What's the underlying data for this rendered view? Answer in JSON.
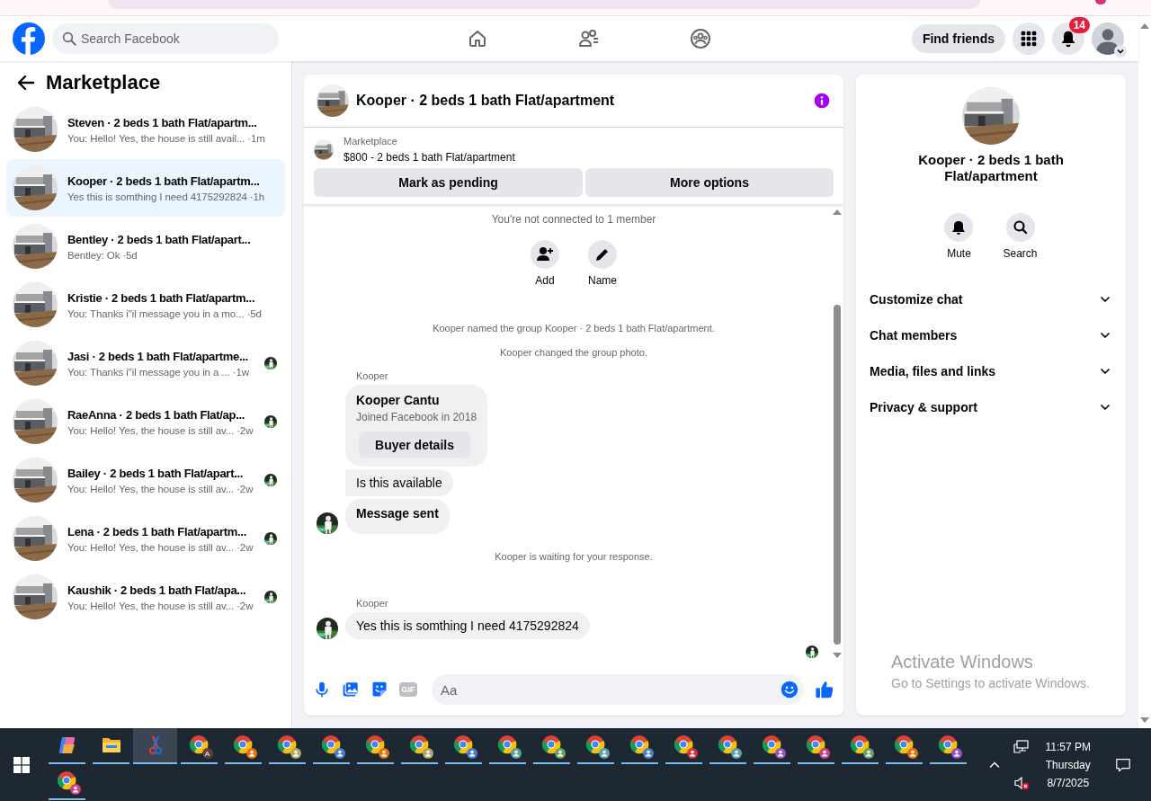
{
  "topbar": {
    "search": {
      "placeholder": "Search Facebook"
    },
    "nav": [
      {
        "kind": "home"
      },
      {
        "kind": "friends"
      },
      {
        "kind": "groups"
      }
    ],
    "find_friends": "Find friends",
    "notifications_count": "14"
  },
  "sidebar": {
    "title": "Marketplace",
    "conversations": [
      {
        "title": "Steven · 2 beds 1 bath Flat/apartm...",
        "preview": "You: Hello! Yes, the house is still avail...",
        "time": "·1m",
        "selected": false,
        "participant": false
      },
      {
        "title": "Kooper · 2 beds 1 bath Flat/apartm...",
        "preview": "Yes this is somthing I need 4175292824",
        "time": "·1h",
        "selected": true,
        "participant": false
      },
      {
        "title": "Bentley · 2 beds 1 bath Flat/apart...",
        "preview": "Bentley: Ok",
        "time": "·5d",
        "selected": false,
        "participant": false
      },
      {
        "title": "Kristie · 2 beds 1 bath Flat/apartm...",
        "preview": "You: Thanks i\"il message you in a mo...",
        "time": "·5d",
        "selected": false,
        "participant": false
      },
      {
        "title": "Jasi · 2 beds 1 bath Flat/apartme...",
        "preview": "You: Thanks i\"il message you in a ...",
        "time": "·1w",
        "selected": false,
        "participant": true
      },
      {
        "title": "RaeAnna · 2 beds 1 bath Flat/ap...",
        "preview": "You: Hello! Yes, the house is still av...",
        "time": "·2w",
        "selected": false,
        "participant": true
      },
      {
        "title": "Bailey · 2 beds 1 bath Flat/apart...",
        "preview": "You: Hello! Yes, the house is still av...",
        "time": "·2w",
        "selected": false,
        "participant": true
      },
      {
        "title": "Lena · 2 beds 1 bath Flat/apartm...",
        "preview": "You: Hello! Yes, the house is still av...",
        "time": "·2w",
        "selected": false,
        "participant": true
      },
      {
        "title": "Kaushik · 2 beds 1 bath Flat/apa...",
        "preview": "You: Hello! Yes, the house is still av...",
        "time": "·2w",
        "selected": false,
        "participant": true
      }
    ]
  },
  "chat": {
    "title": "Kooper · 2 beds 1 bath Flat/apartment",
    "listing": {
      "label": "Marketplace",
      "text": "$800 - 2 beds 1 bath Flat/apartment",
      "buttons": [
        "Mark as pending",
        "More options"
      ]
    },
    "events": [
      {
        "kind": "system",
        "text": "You're not connected to 1 member"
      },
      {
        "kind": "actions",
        "items": [
          {
            "kind": "add",
            "label": "Add"
          },
          {
            "kind": "name",
            "label": "Name"
          }
        ]
      },
      {
        "kind": "system",
        "text": "Kooper named the group Kooper · 2 beds 1 bath Flat/apartment."
      },
      {
        "kind": "system",
        "text": "Kooper changed the group photo."
      },
      {
        "kind": "sender",
        "text": "Kooper"
      },
      {
        "kind": "card",
        "name": "Kooper Cantu",
        "subtitle": "Joined Facebook in 2018",
        "button": "Buyer details"
      },
      {
        "kind": "bubble",
        "text": "Is this available",
        "bold": false,
        "avatar": false
      },
      {
        "kind": "bubble",
        "text": "Message sent",
        "bold": true,
        "avatar": true
      },
      {
        "kind": "system",
        "text": "Kooper is waiting for your response."
      },
      {
        "kind": "sender",
        "text": "Kooper"
      },
      {
        "kind": "bubble",
        "text": "Yes this is somthing I need 4175292824",
        "bold": false,
        "avatar": true
      }
    ],
    "composer": {
      "gif_label": "GIF",
      "placeholder": "Aa"
    }
  },
  "details": {
    "title": "Kooper · 2 beds 1 bath Flat/apartment",
    "actions": [
      {
        "kind": "mute",
        "label": "Mute"
      },
      {
        "kind": "search",
        "label": "Search"
      }
    ],
    "sections": [
      {
        "label": "Customize chat",
        "expanded": false
      },
      {
        "label": "Chat members",
        "expanded": false
      },
      {
        "label": "Media, files and links",
        "expanded": false
      },
      {
        "label": "Privacy & support",
        "expanded": false
      }
    ]
  },
  "activation": {
    "title": "Activate Windows",
    "subtitle": "Go to Settings to activate Windows."
  },
  "taskbar": {
    "items": [
      {
        "kind": "copilot",
        "selected": false
      },
      {
        "kind": "folder",
        "selected": false
      },
      {
        "kind": "tool",
        "selected": true
      },
      {
        "kind": "chrome",
        "color": "#5d4037",
        "badge_text": "A",
        "selected": false
      },
      {
        "kind": "chrome",
        "color": "#e8710a",
        "selected": false
      },
      {
        "kind": "chrome",
        "color": "#b5a46a",
        "selected": false
      },
      {
        "kind": "chrome",
        "color": "#4a7fd0",
        "selected": false
      },
      {
        "kind": "chrome",
        "color": "#e8710a",
        "selected": false
      },
      {
        "kind": "chrome",
        "color": "#b5a46a",
        "selected": false
      },
      {
        "kind": "chrome",
        "color": "#4a7fd0",
        "selected": false
      },
      {
        "kind": "chrome",
        "color": "#5aa0a0",
        "selected": false
      },
      {
        "kind": "chrome",
        "color": "#6aa06a",
        "selected": false
      },
      {
        "kind": "chrome",
        "color": "#5aa0b0",
        "selected": false
      },
      {
        "kind": "chrome",
        "color": "#4a7fd0",
        "selected": false
      },
      {
        "kind": "chrome",
        "color": "#d93040",
        "selected": false
      },
      {
        "kind": "chrome",
        "color": "#5aa0b0",
        "selected": false
      },
      {
        "kind": "chrome",
        "color": "#9a50c0",
        "selected": false
      },
      {
        "kind": "chrome",
        "color": "#d04080",
        "selected": false
      },
      {
        "kind": "chrome",
        "color": "#6aa06a",
        "selected": false
      },
      {
        "kind": "chrome",
        "color": "#e8710a",
        "selected": false
      },
      {
        "kind": "chrome",
        "color": "#9a50c0",
        "selected": false
      },
      {
        "kind": "chrome",
        "color": "#d04080",
        "selected": false
      }
    ],
    "tray": {
      "time": "11:57 PM",
      "day": "Thursday",
      "date": "8/7/2025"
    }
  }
}
